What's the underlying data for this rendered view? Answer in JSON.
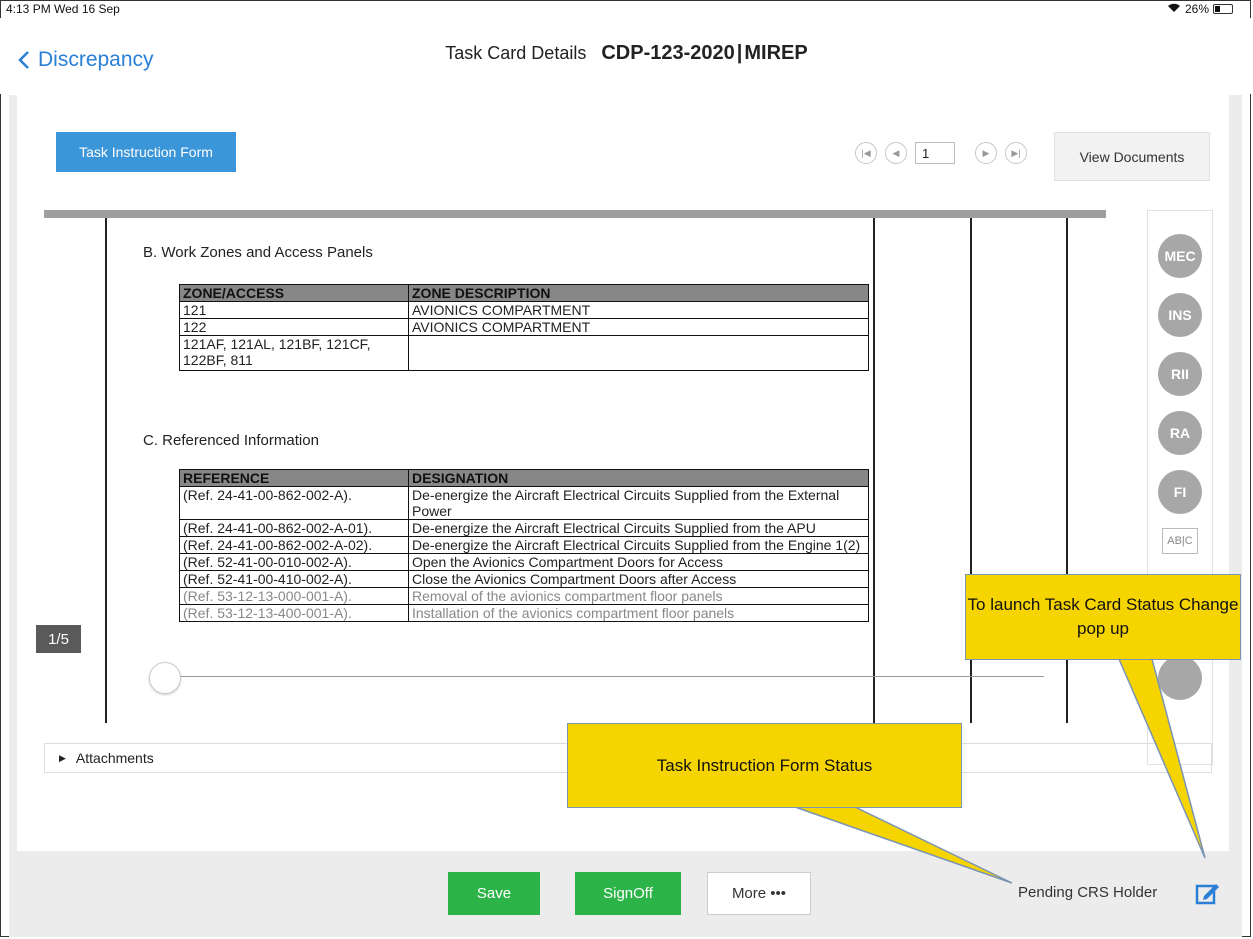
{
  "status_bar": {
    "time": "4:13 PM  Wed 16 Sep",
    "battery": "26%"
  },
  "header": {
    "back_label": "Discrepancy",
    "title": "Task Card Details",
    "task_code": "CDP-123-2020",
    "separator": "|",
    "task_type": "MIREP"
  },
  "toolbar": {
    "form_button": "Task Instruction Form",
    "page_value": "1",
    "view_documents": "View Documents"
  },
  "document": {
    "section_b": "B.   Work Zones and Access Panels",
    "zone_table": {
      "headers": [
        "ZONE/ACCESS",
        "ZONE DESCRIPTION"
      ],
      "rows": [
        [
          "121",
          "AVIONICS COMPARTMENT"
        ],
        [
          "122",
          "AVIONICS COMPARTMENT"
        ],
        [
          "121AF, 121AL, 121BF, 121CF, 122BF, 811",
          ""
        ]
      ]
    },
    "section_c": "C.   Referenced Information",
    "ref_table": {
      "headers": [
        "REFERENCE",
        "DESIGNATION"
      ],
      "rows": [
        [
          "(Ref. 24-41-00-862-002-A).",
          "De-energize the Aircraft Electrical Circuits Supplied from the External Power"
        ],
        [
          "(Ref. 24-41-00-862-002-A-01).",
          "De-energize the Aircraft Electrical Circuits Supplied from the APU"
        ],
        [
          "(Ref. 24-41-00-862-002-A-02).",
          "De-energize the Aircraft Electrical Circuits Supplied from the Engine 1(2)"
        ],
        [
          "(Ref. 52-41-00-010-002-A).",
          "Open the Avionics Compartment Doors for Access"
        ],
        [
          "(Ref. 52-41-00-410-002-A).",
          "Close the Avionics Compartment Doors after Access"
        ],
        [
          "(Ref. 53-12-13-000-001-A).",
          "Removal of the avionics compartment floor panels"
        ],
        [
          "(Ref. 53-12-13-400-001-A).",
          "Installation of the avionics compartment floor panels"
        ]
      ]
    },
    "page_indicator": "1/5"
  },
  "roles": [
    "MEC",
    "INS",
    "RII",
    "RA",
    "FI"
  ],
  "spellcheck_label": "AB|C",
  "attachments_label": "Attachments",
  "footer": {
    "save": "Save",
    "signoff": "SignOff",
    "more": "More •••",
    "status": "Pending CRS Holder"
  },
  "callouts": {
    "status_change": "To launch Task Card Status Change pop up",
    "form_status": "Task Instruction Form Status"
  },
  "colors": {
    "accent": "#3a95d9",
    "link": "#2a7fd6",
    "success": "#2db449",
    "callout": "#f5d400"
  }
}
